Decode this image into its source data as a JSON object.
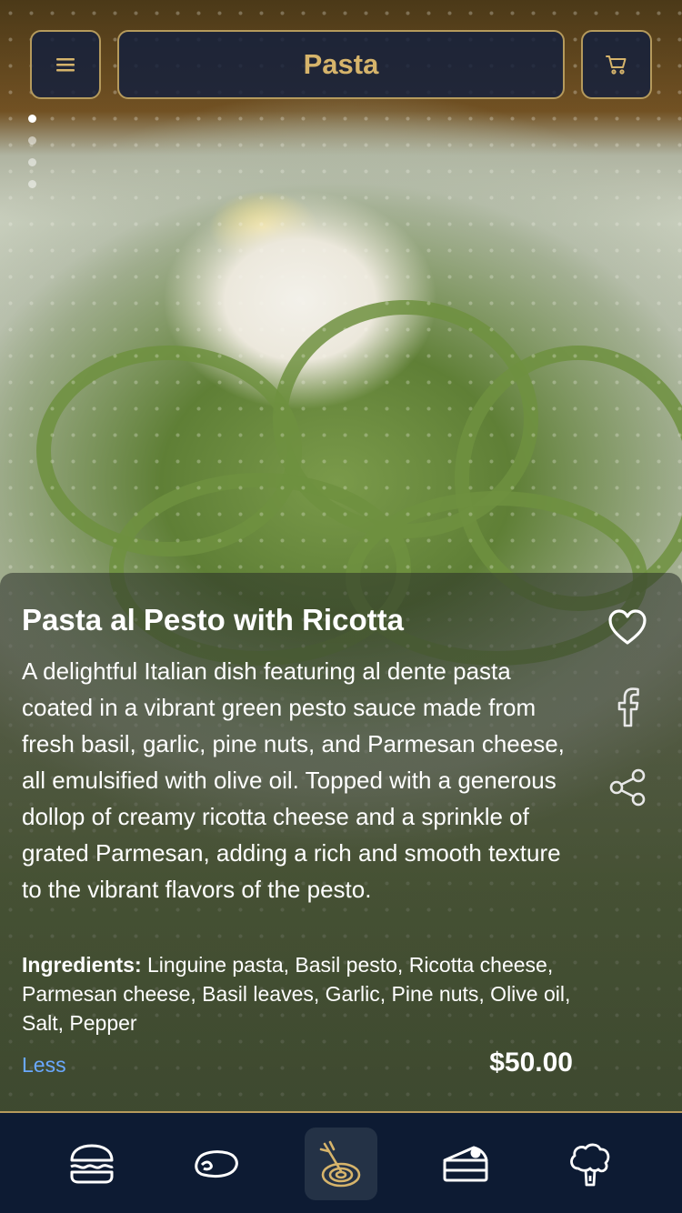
{
  "header": {
    "title": "Pasta",
    "menu_icon": "hamburger-menu-icon",
    "cart_icon": "shopping-cart-icon"
  },
  "carousel": {
    "count": 4,
    "active_index": 0
  },
  "dish": {
    "title": "Pasta al Pesto with Ricotta",
    "description": "A delightful Italian dish featuring al dente pasta coated in a vibrant green pesto sauce made from fresh basil, garlic, pine nuts, and Parmesan cheese, all emulsified with olive oil. Topped with a generous dollop of creamy ricotta cheese and a sprinkle of grated Parmesan, adding a rich and smooth texture to the vibrant flavors of the pesto.",
    "ingredients_label": "Ingredients:",
    "ingredients": "Linguine pasta, Basil pesto, Ricotta cheese, Parmesan cheese, Basil leaves, Garlic, Pine nuts, Olive oil, Salt, Pepper",
    "toggle_label": "Less",
    "price": "$50.00"
  },
  "actions": [
    {
      "name": "favorite",
      "icon": "heart-icon"
    },
    {
      "name": "facebook",
      "icon": "facebook-icon"
    },
    {
      "name": "share",
      "icon": "share-icon"
    }
  ],
  "bottom_nav": [
    {
      "category": "burgers",
      "icon": "burger-icon",
      "active": false
    },
    {
      "category": "steaks",
      "icon": "steak-icon",
      "active": false
    },
    {
      "category": "pasta",
      "icon": "pasta-icon",
      "active": true
    },
    {
      "category": "desserts",
      "icon": "cake-slice-icon",
      "active": false
    },
    {
      "category": "vegetables",
      "icon": "broccoli-icon",
      "active": false
    }
  ],
  "colors": {
    "accent_gold": "#d6b46b",
    "border_gold": "#b59a5c",
    "nav_background": "#0d1b33",
    "link_blue": "#6aa8ff"
  }
}
